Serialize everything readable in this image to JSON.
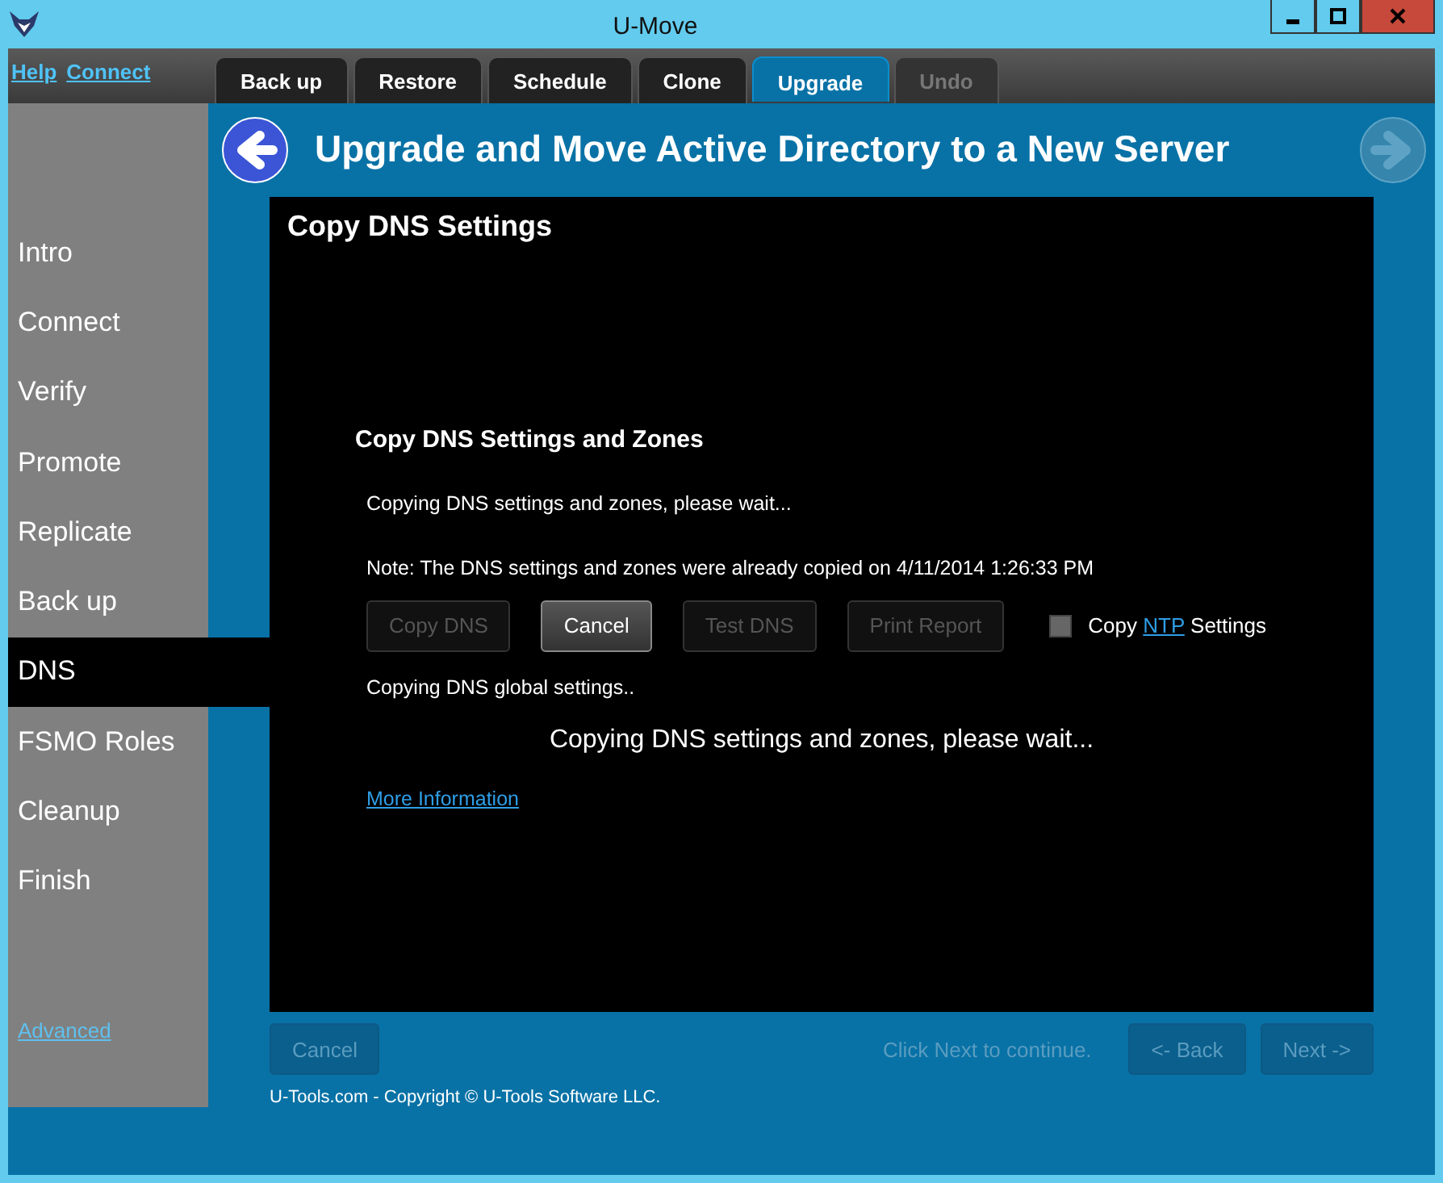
{
  "window": {
    "title": "U-Move"
  },
  "top_links": [
    "Help",
    "Connect"
  ],
  "tabs": [
    {
      "label": "Back up",
      "selected": false,
      "disabled": false
    },
    {
      "label": "Restore",
      "selected": false,
      "disabled": false
    },
    {
      "label": "Schedule",
      "selected": false,
      "disabled": false
    },
    {
      "label": "Clone",
      "selected": false,
      "disabled": false
    },
    {
      "label": "Upgrade",
      "selected": true,
      "disabled": false
    },
    {
      "label": "Undo",
      "selected": false,
      "disabled": true
    }
  ],
  "header": {
    "title": "Upgrade and Move Active Directory to a New Server",
    "nav_arrows": [
      {
        "kind": "back",
        "disabled": false
      },
      {
        "kind": "next",
        "disabled": true
      }
    ]
  },
  "sidebar": {
    "items": [
      {
        "label": "Intro",
        "selected": false
      },
      {
        "label": "Connect",
        "selected": false
      },
      {
        "label": "Verify",
        "selected": false
      },
      {
        "label": "Promote",
        "selected": false
      },
      {
        "label": "Replicate",
        "selected": false
      },
      {
        "label": "Back up",
        "selected": false
      },
      {
        "label": "DNS",
        "selected": true
      },
      {
        "label": "FSMO Roles",
        "selected": false
      },
      {
        "label": "Cleanup",
        "selected": false
      },
      {
        "label": "Finish",
        "selected": false
      }
    ],
    "advanced_link": "Advanced"
  },
  "panel": {
    "title": "Copy DNS Settings",
    "section_title": "Copy DNS Settings and Zones",
    "status": "Copying DNS settings and zones, please wait...",
    "note": "Note: The DNS settings and zones were already copied on 4/11/2014 1:26:33 PM",
    "buttons": [
      {
        "label": "Copy DNS",
        "disabled": true
      },
      {
        "label": "Cancel",
        "disabled": false
      },
      {
        "label": "Test DNS",
        "disabled": true
      },
      {
        "label": "Print Report",
        "disabled": true
      }
    ],
    "checkbox": {
      "label_before": "Copy",
      "link": "NTP",
      "label_after": "Settings",
      "checked": false
    },
    "progress_text": "Copying DNS global settings..",
    "center_message": "Copying DNS settings and zones, please wait...",
    "more_info_link": "More Information"
  },
  "footer": {
    "cancel": {
      "label": "Cancel",
      "disabled": true
    },
    "hint": "Click Next to continue.",
    "nav_buttons": [
      {
        "label": "<- Back",
        "disabled": true
      },
      {
        "label": "Next ->",
        "disabled": true
      }
    ],
    "copyright": "U-Tools.com - Copyright © U-Tools Software LLC."
  }
}
